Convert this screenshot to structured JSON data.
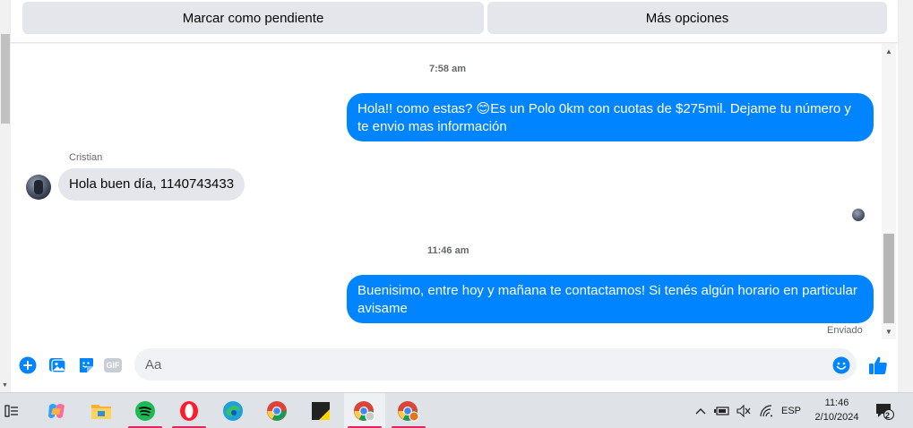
{
  "topbar": {
    "pending_label": "Marcar como pendiente",
    "more_label": "Más opciones"
  },
  "conversation": {
    "timestamp_1": "7:58 am",
    "message_out_1": "Hola!! como estas? 😊Es un Polo 0km con cuotas de $275mil. Dejame tu número y te envio mas información",
    "sender_name": "Cristian",
    "message_in_1": "Hola buen día, 1140743433",
    "timestamp_2": "11:46 am",
    "message_out_2": "Buenisimo, entre hoy y mañana te contactamos! Si tenés algún horario en particular avisame",
    "status": "Enviado"
  },
  "composer": {
    "placeholder": "Aa",
    "gif_label": "GIF"
  },
  "taskbar": {
    "language": "ESP",
    "time": "11:46",
    "date": "2/10/2024",
    "notification_count": "2"
  },
  "colors": {
    "messenger_blue": "#0084ff",
    "incoming_bubble": "#e4e6eb",
    "taskbar": "#dfe3e8"
  }
}
